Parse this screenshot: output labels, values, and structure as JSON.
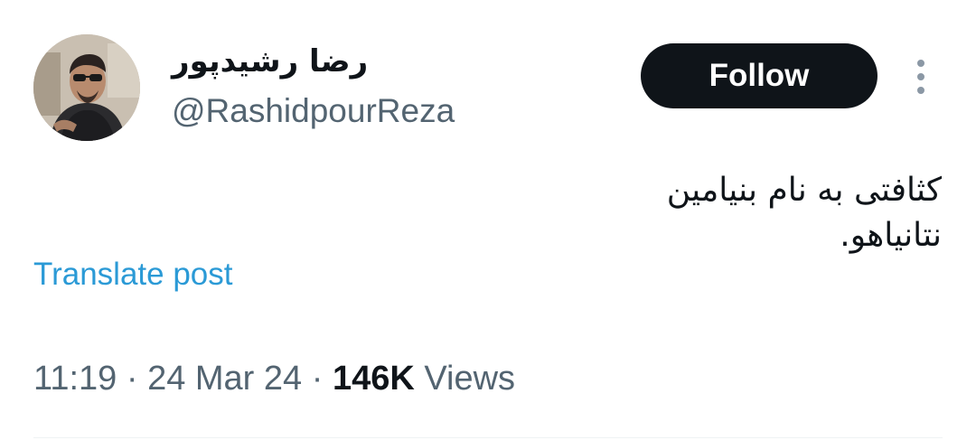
{
  "author": {
    "display_name": "رضا رشیدپور",
    "handle": "@RashidpourReza"
  },
  "follow_label": "Follow",
  "tweet": {
    "text_line1": "کثافتی به نام بنیامین",
    "text_line2": "نتانیاهو."
  },
  "translate_label": "Translate post",
  "meta": {
    "time": "11:19",
    "sep1": " · ",
    "date": "24 Mar 24",
    "sep2": " · ",
    "views_count": "146K",
    "views_label": " Views"
  },
  "icons": {
    "more": "more-vertical-icon"
  },
  "colors": {
    "follow_bg": "#0f1419",
    "link": "#2b9ad6",
    "secondary": "#536471"
  }
}
